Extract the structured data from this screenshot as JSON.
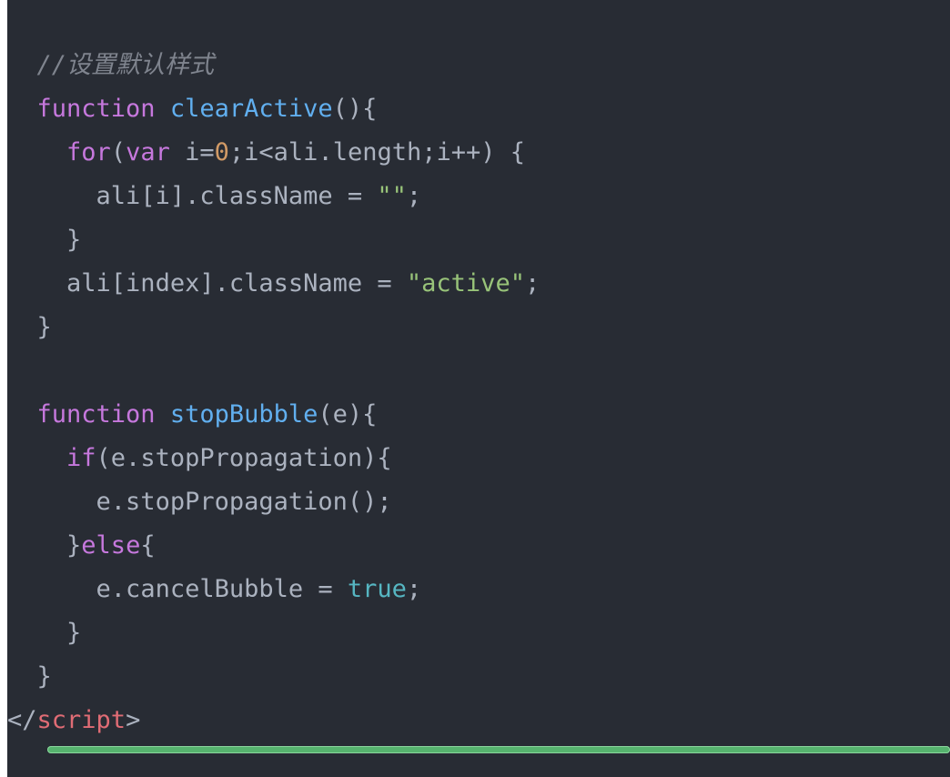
{
  "code_lines": [
    {
      "indent": "  ",
      "tokens": [
        {
          "t": "//设置默认样式",
          "c": "comment"
        }
      ]
    },
    {
      "indent": "  ",
      "tokens": [
        {
          "t": "function",
          "c": "keyword"
        },
        {
          "t": " ",
          "c": "plain"
        },
        {
          "t": "clearActive",
          "c": "fn"
        },
        {
          "t": "(){",
          "c": "plain"
        }
      ]
    },
    {
      "indent": "    ",
      "tokens": [
        {
          "t": "for",
          "c": "keyword"
        },
        {
          "t": "(",
          "c": "plain"
        },
        {
          "t": "var",
          "c": "keyword"
        },
        {
          "t": " i=",
          "c": "plain"
        },
        {
          "t": "0",
          "c": "num"
        },
        {
          "t": ";i<ali.length;i++) {",
          "c": "plain"
        }
      ]
    },
    {
      "indent": "      ",
      "tokens": [
        {
          "t": "ali[i].className = ",
          "c": "plain"
        },
        {
          "t": "\"\"",
          "c": "str"
        },
        {
          "t": ";",
          "c": "plain"
        }
      ]
    },
    {
      "indent": "    ",
      "tokens": [
        {
          "t": "}",
          "c": "plain"
        }
      ]
    },
    {
      "indent": "    ",
      "tokens": [
        {
          "t": "ali[index].className = ",
          "c": "plain"
        },
        {
          "t": "\"active\"",
          "c": "str"
        },
        {
          "t": ";",
          "c": "plain"
        }
      ]
    },
    {
      "indent": "  ",
      "tokens": [
        {
          "t": "}",
          "c": "plain"
        }
      ]
    },
    {
      "indent": "",
      "tokens": []
    },
    {
      "indent": "  ",
      "tokens": [
        {
          "t": "function",
          "c": "keyword"
        },
        {
          "t": " ",
          "c": "plain"
        },
        {
          "t": "stopBubble",
          "c": "fn"
        },
        {
          "t": "(e){",
          "c": "plain"
        }
      ]
    },
    {
      "indent": "    ",
      "tokens": [
        {
          "t": "if",
          "c": "keyword"
        },
        {
          "t": "(e.stopPropagation){",
          "c": "plain"
        }
      ]
    },
    {
      "indent": "      ",
      "tokens": [
        {
          "t": "e.stopPropagation();",
          "c": "plain"
        }
      ]
    },
    {
      "indent": "    ",
      "tokens": [
        {
          "t": "}",
          "c": "plain"
        },
        {
          "t": "else",
          "c": "keyword"
        },
        {
          "t": "{",
          "c": "plain"
        }
      ]
    },
    {
      "indent": "      ",
      "tokens": [
        {
          "t": "e.cancelBubble = ",
          "c": "plain"
        },
        {
          "t": "true",
          "c": "bool"
        },
        {
          "t": ";",
          "c": "plain"
        }
      ]
    },
    {
      "indent": "    ",
      "tokens": [
        {
          "t": "}",
          "c": "plain"
        }
      ]
    },
    {
      "indent": "  ",
      "tokens": [
        {
          "t": "}",
          "c": "plain"
        }
      ]
    },
    {
      "indent": "",
      "tokens": [
        {
          "t": "</",
          "c": "plain"
        },
        {
          "t": "script",
          "c": "tag"
        },
        {
          "t": ">",
          "c": "plain"
        }
      ]
    }
  ],
  "progress": {
    "value": 1.0,
    "color": "#56b36e"
  },
  "theme": {
    "background": "#282c34",
    "comment": "#7f848e",
    "keyword": "#c678dd",
    "function": "#61afef",
    "number": "#d19a66",
    "string": "#98c379",
    "boolean": "#56b6c2",
    "tag": "#e06c75",
    "text": "#abb2bf"
  }
}
